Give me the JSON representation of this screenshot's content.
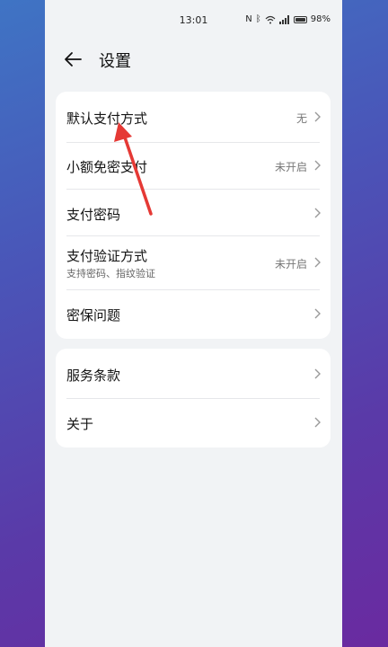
{
  "status": {
    "time": "13:01",
    "battery": "98%"
  },
  "header": {
    "title": "设置",
    "back_icon": "arrow-left-icon"
  },
  "group1": [
    {
      "label": "默认支付方式",
      "value": "无"
    },
    {
      "label": "小额免密支付",
      "value": "未开启"
    },
    {
      "label": "支付密码",
      "value": ""
    },
    {
      "label": "支付验证方式",
      "sub": "支持密码、指纹验证",
      "value": "未开启"
    },
    {
      "label": "密保问题",
      "value": ""
    }
  ],
  "group2": [
    {
      "label": "服务条款"
    },
    {
      "label": "关于"
    }
  ],
  "annotation": {
    "color": "#e53935"
  }
}
